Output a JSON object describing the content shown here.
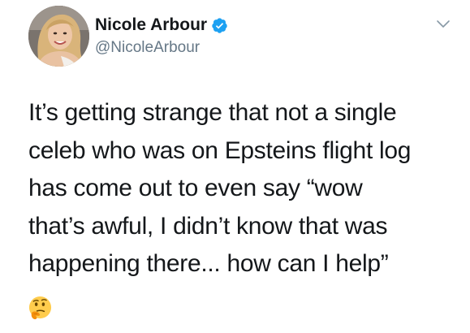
{
  "author": {
    "display_name": "Nicole Arbour",
    "handle": "@NicoleArbour",
    "verified": true,
    "verified_color": "#1da1f2"
  },
  "tweet": {
    "lines": [
      "It’s getting strange that not a single",
      "celeb who was on Epsteins flight log",
      "has come out to even say “wow",
      "that’s awful, I didn’t know that was",
      "happening there... how can I help”"
    ],
    "emoji": "thinking-face-emoji"
  },
  "icons": {
    "menu": "chevron-down-icon",
    "verified": "verified-badge-icon"
  }
}
